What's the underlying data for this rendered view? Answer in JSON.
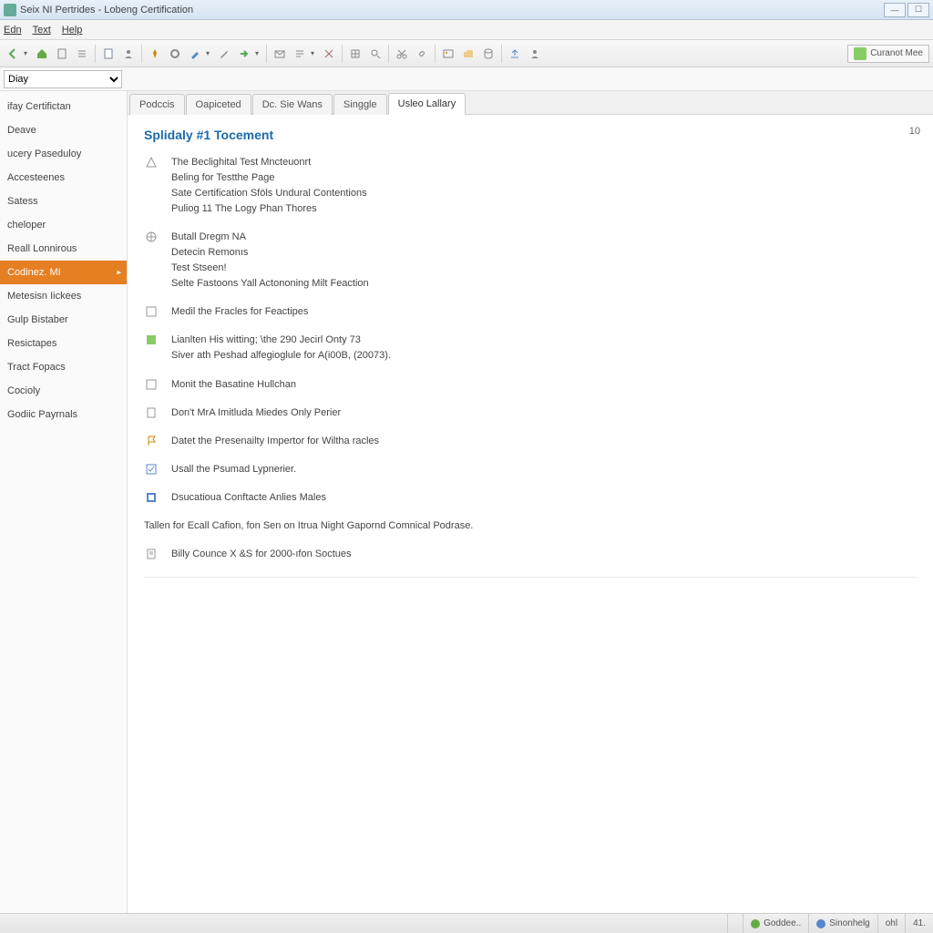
{
  "window": {
    "title": "Seix NI Pertrides - Lobeng Certification"
  },
  "menu": {
    "edit": "Edn",
    "text": "Text",
    "help": "Help"
  },
  "selectrow": {
    "value": "Diay"
  },
  "toolbar_right": {
    "label": "Curanot Mee"
  },
  "sidebar": {
    "items": [
      "ifay Certifictan",
      "Deave",
      "ucery Paseduloy",
      "Accesteenes",
      "Satess",
      "cheloper",
      "Reall Lonnirous",
      "Codinez. MI",
      "Metesisn Iickees",
      "Gulp Bistaber",
      "Resictapes",
      "Tract Fopacs",
      "Cocioly",
      "Godiic Payrnals"
    ],
    "selected_index": 7
  },
  "tabs": {
    "items": [
      "Podccis",
      "Oapiceted",
      "Dc. Sie Wans",
      "Singgle",
      "Usleo Lallary"
    ],
    "active_index": 4
  },
  "page_number": "10",
  "content": {
    "heading": "Splidaly #1 Tocement",
    "blocks": [
      {
        "icon": "warning-icon",
        "lines": [
          "The Beclighital Test Mncteuonrt",
          "Beling for Testthe Page",
          "Sate Certification Sföls Undural Contentions",
          "Puliog 11 The Logy Phan Thores"
        ]
      },
      {
        "icon": "globe-icon",
        "lines": [
          "Butall Dregm NA",
          "Detecin Remonıs",
          "Test Stseen!",
          "Selte Fastoons Yall Actononing Milt Feaction"
        ]
      },
      {
        "icon": "checkbox-icon",
        "lines": [
          "Medil the Fracles for Feactipes"
        ]
      },
      {
        "icon": "box-green-icon",
        "lines": [
          "Lianlten His witting; \\the 290 Jecirl Onty 73",
          "Siver ath Peshad alfegioglule for A(i00B, (20073)."
        ]
      },
      {
        "icon": "checkbox-icon",
        "lines": [
          "Monit the Basatine Hullchan"
        ]
      },
      {
        "icon": "doc-icon",
        "lines": [
          "Don't MrA Imitluda Miedes Only Perier"
        ]
      },
      {
        "icon": "flag-icon",
        "lines": [
          "Datet the Presenailty Impertor for Wiltha racles"
        ]
      },
      {
        "icon": "check-blue-icon",
        "lines": [
          "Usall the Psumad Lypnerier."
        ]
      },
      {
        "icon": "square-blue-icon",
        "lines": [
          "Dsucatioua Conftacte Anlies Males"
        ]
      }
    ],
    "plain_line": "Tallen for Ecall Cafion, fon Sen on Itrua Night Gapornd Comnical Podrase.",
    "last_block": {
      "icon": "note-icon",
      "lines": [
        "Billy Counce X &S for 2000-ıfon Soctues"
      ]
    }
  },
  "status": {
    "a": "Goddee..",
    "b": "Sinonhelg",
    "c": "ohl",
    "d": "41."
  }
}
